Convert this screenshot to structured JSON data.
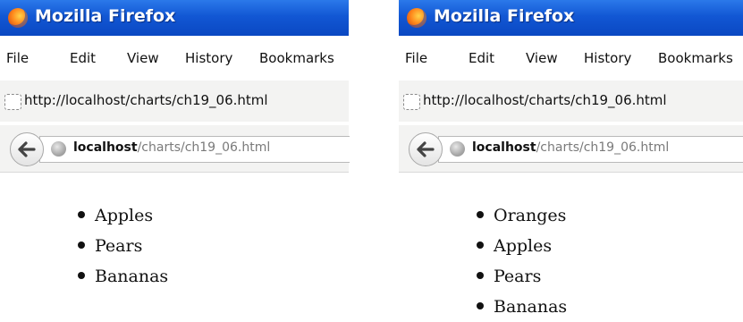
{
  "windows": [
    {
      "title": "Mozilla Firefox",
      "menu": [
        "File",
        "Edit",
        "View",
        "History",
        "Bookmarks"
      ],
      "url": "http://localhost/charts/ch19_06.html",
      "address_host": "localhost",
      "address_path": "/charts/ch19_06.html",
      "items": [
        "Apples",
        "Pears",
        "Bananas"
      ]
    },
    {
      "title": "Mozilla Firefox",
      "menu": [
        "File",
        "Edit",
        "View",
        "History",
        "Bookmarks"
      ],
      "url": "http://localhost/charts/ch19_06.html",
      "address_host": "localhost",
      "address_path": "/charts/ch19_06.html",
      "items": [
        "Oranges",
        "Apples",
        "Pears",
        "Bananas"
      ]
    }
  ]
}
